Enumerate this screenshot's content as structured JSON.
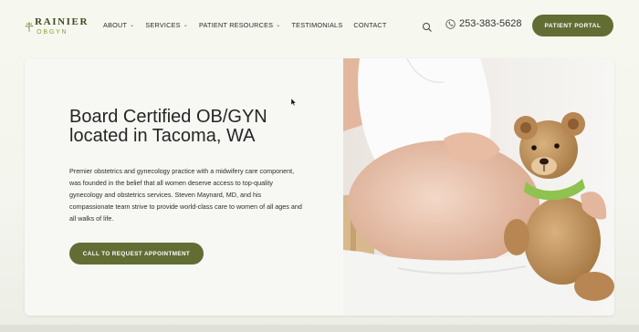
{
  "brand": {
    "name": "RAINIER",
    "sub": "OBGYN"
  },
  "nav": [
    {
      "label": "ABOUT",
      "has_dropdown": true
    },
    {
      "label": "SERVICES",
      "has_dropdown": true
    },
    {
      "label": "PATIENT RESOURCES",
      "has_dropdown": true
    },
    {
      "label": "TESTIMONIALS",
      "has_dropdown": false
    },
    {
      "label": "CONTACT",
      "has_dropdown": false
    }
  ],
  "header": {
    "phone": "253-383-5628",
    "portal_label": "PATIENT PORTAL",
    "search_icon": "search-icon",
    "phone_icon": "phone-icon"
  },
  "hero": {
    "title_line1": "Board Certified OB/GYN",
    "title_line2": "located in Tacoma, WA",
    "description": "Premier obstetrics and gynecology practice with a midwifery care component, was founded in the belief that all women deserve access to top-quality gynecology and obstetrics services. Steven Maynard, MD, and his compassionate team strive to provide world-class care to women of all ages and all walks of life.",
    "cta_label": "CALL TO REQUEST APPOINTMENT"
  },
  "colors": {
    "accent": "#626d34",
    "logo_green": "#8da03a",
    "logo_dark": "#3d4a22",
    "background": "#f4f5ee"
  }
}
